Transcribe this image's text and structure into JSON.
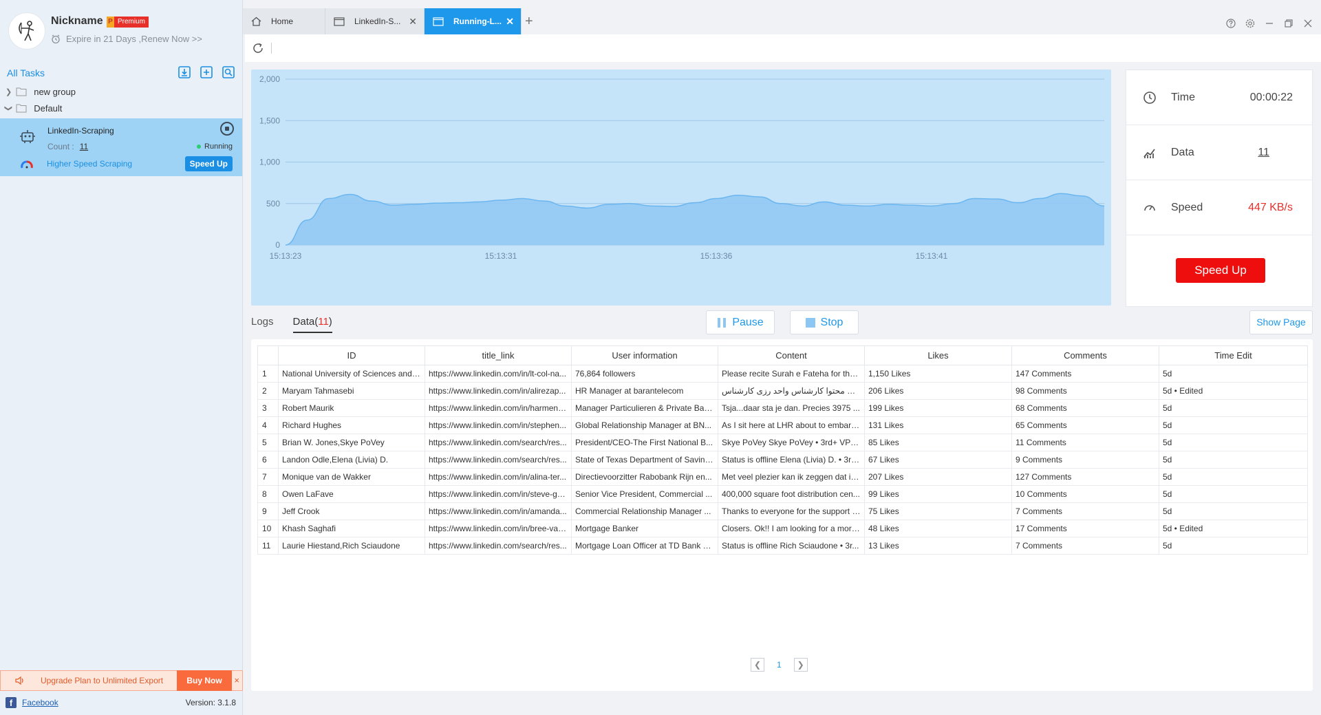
{
  "profile": {
    "nickname": "Nickname",
    "badge_letter": "P",
    "badge_text": "Premium",
    "expire_text": "Expire in 21 Days ,Renew Now >>"
  },
  "tasks": {
    "header": "All Tasks",
    "groups": [
      {
        "label": "new group",
        "expanded": false
      },
      {
        "label": "Default",
        "expanded": true
      }
    ],
    "task": {
      "name": "LinkedIn-Scraping",
      "count_label": "Count :",
      "count_value": "11",
      "status": "Running",
      "speed_label": "Higher Speed Scraping",
      "speed_button": "Speed Up"
    }
  },
  "upgrade": {
    "message": "Upgrade Plan to Unlimited Export",
    "buy_label": "Buy Now",
    "close": "×"
  },
  "footer": {
    "link": "Facebook",
    "version": "Version: 3.1.8"
  },
  "tabs": [
    {
      "label": "Home",
      "active": false
    },
    {
      "label": "LinkedIn-S...",
      "active": false
    },
    {
      "label": "Running-L...",
      "active": true
    }
  ],
  "stats": {
    "time_label": "Time",
    "time_value": "00:00:22",
    "data_label": "Data",
    "data_value": "11",
    "speed_label": "Speed",
    "speed_value": "447 KB/s",
    "speed_button": "Speed Up"
  },
  "chart_data": {
    "type": "area",
    "x_ticks": [
      "15:13:23",
      "15:13:31",
      "15:13:36",
      "15:13:41"
    ],
    "y_ticks": [
      "0",
      "500",
      "1,000",
      "1,500",
      "2,000"
    ],
    "ylim": [
      0,
      2000
    ],
    "series": [
      {
        "values": [
          0,
          300,
          560,
          610,
          530,
          480,
          490,
          505,
          510,
          520,
          540,
          560,
          530,
          470,
          445,
          490,
          500,
          470,
          465,
          510,
          560,
          600,
          580,
          500,
          470,
          520,
          480,
          470,
          490,
          480,
          470,
          500,
          560,
          555,
          510,
          560,
          620,
          590,
          470
        ]
      }
    ],
    "fill_color": "#8fc8f4",
    "line_color": "#6cb6ef"
  },
  "data_tabs": {
    "logs": "Logs",
    "data": "Data",
    "data_count": "11"
  },
  "controls": {
    "pause": "Pause",
    "stop": "Stop",
    "show_page": "Show Page"
  },
  "table": {
    "columns": [
      "ID",
      "title_link",
      "User information",
      "Content",
      "Likes",
      "Comments",
      "Time Edit"
    ],
    "rows": [
      [
        "1",
        "National University of Sciences and Technology",
        "https://www.linkedin.com/in/lt-col-na...",
        "76,864 followers",
        "Please recite Surah e Fateha for the...",
        "1,150 Likes",
        "147 Comments",
        "5d"
      ],
      [
        "2",
        "Maryam Tahmasebi",
        "https://www.linkedin.com/in/alirezap...",
        "HR Manager at barantelecom",
        "رشناس تامین محتوا کارشناس واحد رزی کارشناس...",
        "206 Likes",
        "98 Comments",
        "5d • Edited"
      ],
      [
        "3",
        "Robert Maurik",
        "https://www.linkedin.com/in/harmen-...",
        "Manager Particulieren & Private Ban...",
        "Tsja...daar sta je dan. Precies 3975 ...",
        "199 Likes",
        "68 Comments",
        "5d"
      ],
      [
        "4",
        "Richard Hughes",
        "https://www.linkedin.com/in/stephen...",
        "Global Relationship Manager at BN...",
        "As I sit here at LHR about to embark...",
        "131 Likes",
        "65 Comments",
        "5d"
      ],
      [
        "5",
        "Brian W. Jones,Skye PoVey",
        "https://www.linkedin.com/search/res...",
        "President/CEO-The First National B...",
        "Skye PoVey Skye PoVey • 3rd+ VP o...",
        "85 Likes",
        "11 Comments",
        "5d"
      ],
      [
        "6",
        "Landon Odle,Elena (Livia) D.",
        "https://www.linkedin.com/search/res...",
        "State of Texas Department of Saving...",
        "Status is offline Elena (Livia) D. • 3rd...",
        "67 Likes",
        "9 Comments",
        "5d"
      ],
      [
        "7",
        "Monique van de Wakker",
        "https://www.linkedin.com/in/alina-ter...",
        "Directievoorzitter Rabobank Rijn en...",
        "Met veel plezier kan ik zeggen dat ik...",
        "207 Likes",
        "127 Comments",
        "5d"
      ],
      [
        "8",
        "Owen LaFave",
        "https://www.linkedin.com/in/steve-gri...",
        "Senior Vice President, Commercial ...",
        "400,000 square foot distribution cen...",
        "99 Likes",
        "10 Comments",
        "5d"
      ],
      [
        "9",
        "Jeff Crook",
        "https://www.linkedin.com/in/amanda...",
        "Commercial Relationship Manager ...",
        "Thanks to everyone for the support o...",
        "75 Likes",
        "7 Comments",
        "5d"
      ],
      [
        "10",
        "Khash Saghafi",
        "https://www.linkedin.com/in/bree-vau...",
        "Mortgage Banker",
        "Closers. Ok!! I am looking for a mortg...",
        "48 Likes",
        "17 Comments",
        "5d • Edited"
      ],
      [
        "11",
        "Laurie Hiestand,Rich Sciaudone",
        "https://www.linkedin.com/search/res...",
        "Mortgage Loan Officer at TD Bank N...",
        "Status is offline Rich Sciaudone • 3r...",
        "13 Likes",
        "7 Comments",
        "5d"
      ]
    ]
  },
  "pagination": {
    "current": "1"
  }
}
